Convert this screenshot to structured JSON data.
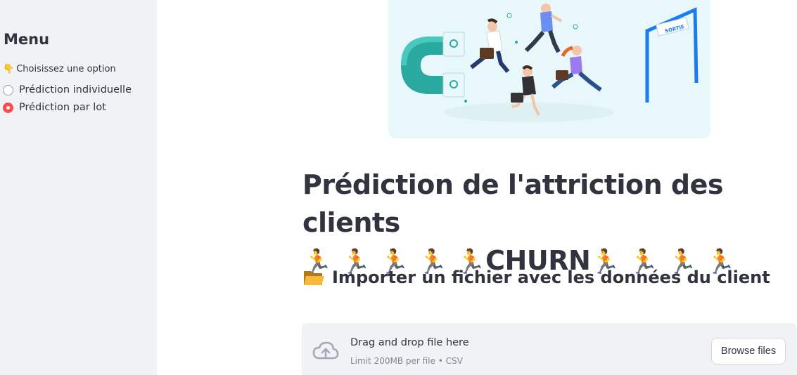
{
  "sidebar": {
    "title": "Menu",
    "option_prompt": "Choisissez une option",
    "option_prompt_icon": "pointing-down-hand-emoji",
    "options": [
      {
        "label": "Prédiction individuelle",
        "selected": false
      },
      {
        "label": "Prédiction par lot",
        "selected": true
      }
    ]
  },
  "hero": {
    "illustration": "people-running-away-from-magnet-to-exit",
    "exit_sign": "SORTIE"
  },
  "title": {
    "line1": "Prédiction de l'attriction des clients",
    "runner_emoji": "🏃",
    "churn_word": "CHURN"
  },
  "subheader": {
    "icon": "folder-icon",
    "text": "Importer un fichier avec les données du client"
  },
  "uploader": {
    "drop_text": "Drag and drop file here",
    "limit_text": "Limit 200MB per file • CSV",
    "button_label": "Browse files"
  },
  "colors": {
    "sidebar_bg": "#f0f2f6",
    "accent": "#ff4b4b",
    "text": "#31333f",
    "muted": "#808495"
  }
}
